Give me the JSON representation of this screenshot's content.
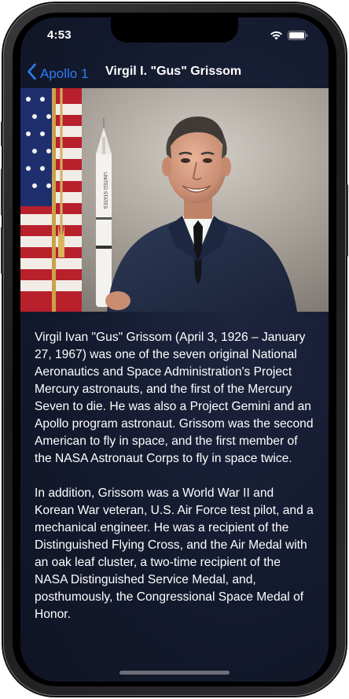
{
  "status_bar": {
    "time": "4:53"
  },
  "nav": {
    "back_label": "Apollo 1",
    "title": "Virgil I. \"Gus\" Grissom"
  },
  "bio": {
    "paragraphs": [
      "Virgil Ivan \"Gus\" Grissom (April 3, 1926 – January 27, 1967) was one of the seven original National Aeronautics and Space Administration's Project Mercury astronauts, and the first of the Mercury Seven to die. He was also a Project Gemini and an Apollo program astronaut. Grissom was the second American to fly in space, and the first member of the NASA Astronaut Corps to fly in space twice.",
      "In addition, Grissom was a World War II and Korean War veteran, U.S. Air Force test pilot, and a mechanical engineer. He was a recipient of the Distinguished Flying Cross, and the Air Medal with an oak leaf cluster, a two-time recipient of the NASA Distinguished Service Medal, and, posthumously, the Congressional Space Medal of Honor."
    ]
  },
  "photo": {
    "rocket_text": "UNITED STATES"
  },
  "colors": {
    "accent": "#2f7cf6",
    "background": "#141a2e",
    "text": "#ffffff"
  },
  "icons": {
    "back": "chevron-left-icon",
    "wifi": "wifi-icon",
    "battery": "battery-icon"
  }
}
